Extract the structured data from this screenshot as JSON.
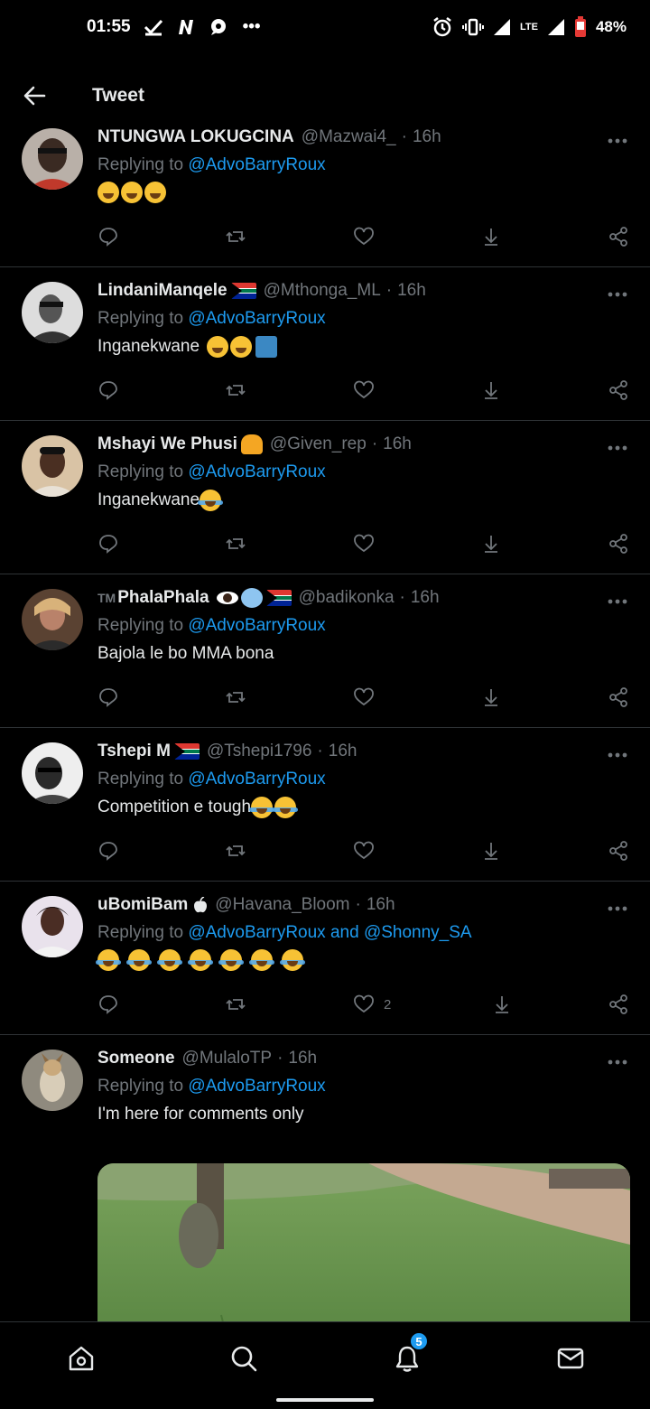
{
  "status_bar": {
    "time": "01:55",
    "lte": "LTE",
    "battery": "48%",
    "more": "•••"
  },
  "header": {
    "title": "Tweet"
  },
  "replying_prefix": "Replying to",
  "tweets": [
    {
      "name": "NTUNGWA LOKUGCINA",
      "handle": "@Mazwai4_",
      "time": "16h",
      "mentions": [
        "@AdvoBarryRoux"
      ],
      "text": "",
      "emoji": [
        "rofl",
        "rofl",
        "rofl"
      ]
    },
    {
      "name": "LindaniManqele",
      "handle": "@Mthonga_ML",
      "time": "16h",
      "mentions": [
        "@AdvoBarryRoux"
      ],
      "text": "Inganekwane",
      "emoji": [
        "eyeroll",
        "thinking",
        "litter"
      ]
    },
    {
      "name": "Mshayi We Phusi",
      "handle": "@Given_rep",
      "time": "16h",
      "mentions": [
        "@AdvoBarryRoux"
      ],
      "text": "Inganekwane",
      "emoji": [
        "joy"
      ]
    },
    {
      "name": "PhalaPhala",
      "name_prefix": "TM",
      "handle": "@badikonka",
      "time": "16h",
      "mentions": [
        "@AdvoBarryRoux"
      ],
      "text": "Bajola le bo MMA bona",
      "emoji": []
    },
    {
      "name": "Tshepi M",
      "handle": "@Tshepi1796",
      "time": "16h",
      "mentions": [
        "@AdvoBarryRoux"
      ],
      "text": "Competition e tough",
      "emoji": [
        "sob",
        "sob"
      ]
    },
    {
      "name": "uBomiBam",
      "handle": "@Havana_Bloom",
      "time": "16h",
      "mentions": [
        "@AdvoBarryRoux",
        "@Shonny_SA"
      ],
      "mention_joiner": "and",
      "text": "",
      "emoji": [
        "joy",
        "joy",
        "joy",
        "joy",
        "joy",
        "joy",
        "joy"
      ],
      "like_count": "2"
    },
    {
      "name": "Someone",
      "handle": "@MulaloTP",
      "time": "16h",
      "mentions": [
        "@AdvoBarryRoux"
      ],
      "text": "I'm here for comments only",
      "emoji": [],
      "has_media": true
    }
  ],
  "bottom_nav": {
    "items": [
      "home-icon",
      "search-icon",
      "bell-icon",
      "mail-icon"
    ],
    "notification_count": "5"
  },
  "colors": {
    "background": "#000000",
    "accent": "#1d9bf0",
    "muted": "#71767b",
    "divider": "#2f3336"
  }
}
